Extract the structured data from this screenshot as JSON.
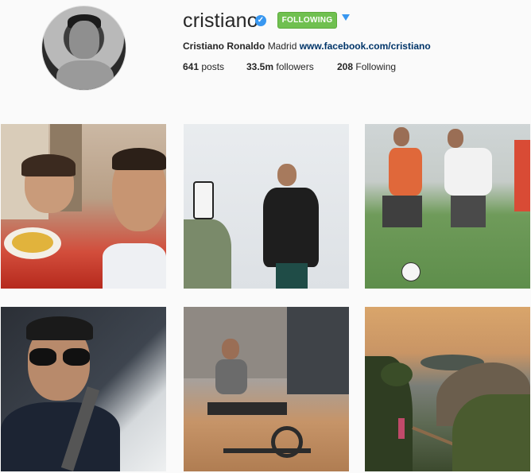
{
  "profile": {
    "username": "cristiano",
    "verified_icon": "verified-badge-icon",
    "follow_label": "FOLLOWING",
    "follow_color": "#70c050",
    "dropdown_icon": "caret-down-icon",
    "full_name": "Cristiano Ronaldo",
    "bio_text": "Madrid",
    "website": "www.facebook.com/cristiano",
    "link_color": "#003569"
  },
  "stats": {
    "posts_count": "641",
    "posts_label": "posts",
    "followers_count": "33.5m",
    "followers_label": "followers",
    "following_count": "208",
    "following_label": "Following"
  }
}
